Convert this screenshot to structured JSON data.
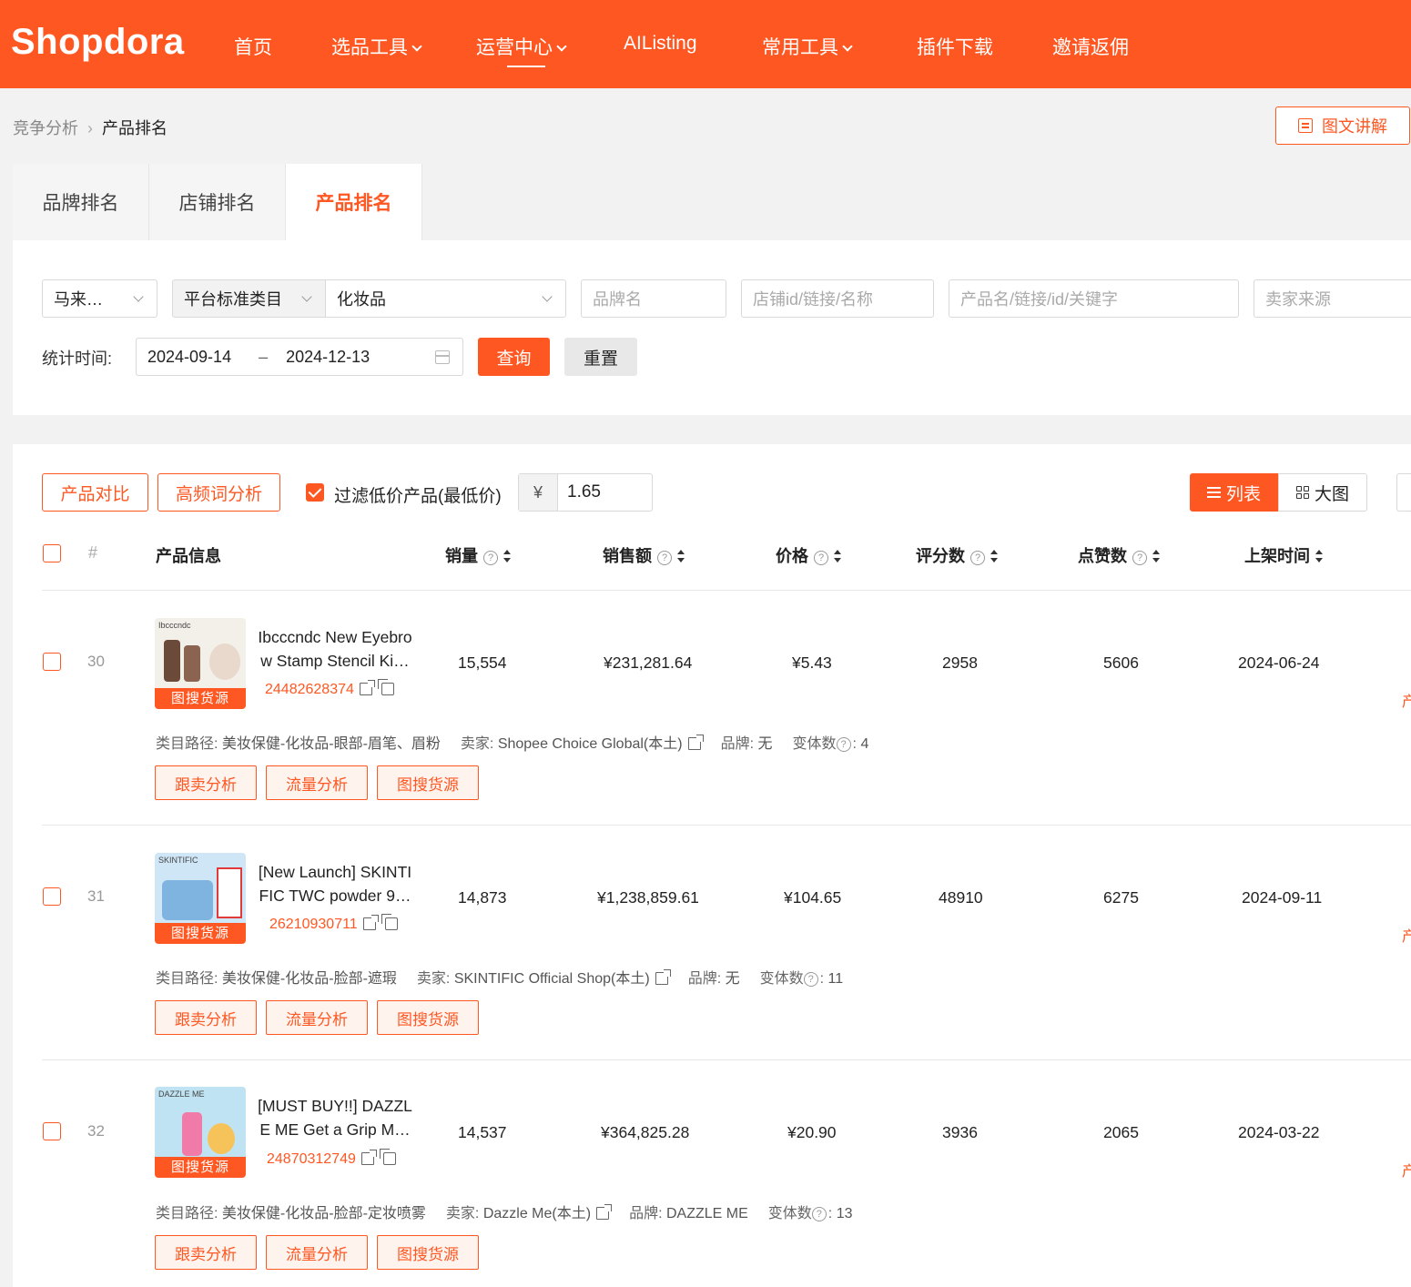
{
  "brand": {
    "logo": "Shopdora"
  },
  "nav": [
    {
      "label": "首页",
      "has_menu": false
    },
    {
      "label": "选品工具",
      "has_menu": true
    },
    {
      "label": "运营中心",
      "has_menu": true,
      "active": true
    },
    {
      "label": "AIListing",
      "has_menu": false
    },
    {
      "label": "常用工具",
      "has_menu": true
    },
    {
      "label": "插件下载",
      "has_menu": false
    },
    {
      "label": "邀请返佣",
      "has_menu": false
    }
  ],
  "breadcrumb": {
    "parent": "竞争分析",
    "current": "产品排名"
  },
  "guide_button": "图文讲解",
  "tabs": [
    {
      "label": "品牌排名"
    },
    {
      "label": "店铺排名"
    },
    {
      "label": "产品排名",
      "active": true
    }
  ],
  "filters": {
    "market": "马来…",
    "category_type": "平台标准类目",
    "category": "化妆品",
    "brand_placeholder": "品牌名",
    "shop_placeholder": "店铺id/链接/名称",
    "product_placeholder": "产品名/链接/id/关键字",
    "seller_source_placeholder": "卖家来源",
    "time_label": "统计时间:",
    "date_start": "2024-09-14",
    "date_sep": "–",
    "date_end": "2024-12-13",
    "query_button": "查询",
    "reset_button": "重置"
  },
  "toolbar": {
    "compare_button": "产品对比",
    "keyword_button": "高频词分析",
    "filter_low_price_label": "过滤低价产品(最低价)",
    "filter_low_price_checked": true,
    "currency": "¥",
    "min_price": "1.65",
    "view_list": "列表",
    "view_grid": "大图"
  },
  "table": {
    "columns": {
      "index": "#",
      "info": "产品信息",
      "sales": "销量",
      "revenue": "销售额",
      "price": "价格",
      "rating_count": "评分数",
      "likes": "点赞数",
      "listed": "上架时间"
    },
    "image_badge": "图搜货源",
    "meta_labels": {
      "category": "类目路径:",
      "seller": "卖家:",
      "brand": "品牌:",
      "variants": "变体数",
      "variants_suffix": ":"
    },
    "action_labels": {
      "follow": "跟卖分析",
      "traffic": "流量分析",
      "image_search": "图搜货源"
    },
    "rows": [
      {
        "rank": "30",
        "name": "Ibcccndc New Eyebrow Stamp Stencil Ki…",
        "name_line1": "Ibcccndc New Eyebro",
        "name_line2": "w Stamp Stencil Ki…",
        "thumb_text": "Ibcccndc",
        "thumb_color": "#f3efe9",
        "id": "24482628374",
        "sales": "15,554",
        "revenue": "¥231,281.64",
        "price": "¥5.43",
        "rating_count": "2958",
        "likes": "5606",
        "listed": "2024-06-24",
        "category_path": "美妆保健-化妆品-眼部-眉笔、眉粉",
        "seller": "Shopee Choice Global(本土)",
        "brand": "无",
        "variants": "4"
      },
      {
        "rank": "31",
        "name": "[New Launch] SKINTIFIC TWC powder 9…",
        "name_line1": "[New Launch] SKINTI",
        "name_line2": "FIC TWC powder 9…",
        "thumb_text": "SKINTIFIC",
        "thumb_color": "#cfe6f7",
        "id": "26210930711",
        "sales": "14,873",
        "revenue": "¥1,238,859.61",
        "price": "¥104.65",
        "rating_count": "48910",
        "likes": "6275",
        "listed": "2024-09-11",
        "category_path": "美妆保健-化妆品-脸部-遮瑕",
        "seller": "SKINTIFIC Official Shop(本土)",
        "brand": "无",
        "variants": "11"
      },
      {
        "rank": "32",
        "name": "[MUST BUY!!] DAZZLE ME Get a Grip M…",
        "name_line1": "[MUST BUY!!] DAZZL",
        "name_line2": "E ME Get a Grip M…",
        "thumb_text": "DAZZLE ME",
        "thumb_color": "#bfe3f3",
        "id": "24870312749",
        "sales": "14,537",
        "revenue": "¥364,825.28",
        "price": "¥20.90",
        "rating_count": "3936",
        "likes": "2065",
        "listed": "2024-03-22",
        "category_path": "美妆保健-化妆品-脸部-定妆喷雾",
        "seller": "Dazzle Me(本土)",
        "brand": "DAZZLE ME",
        "variants": "13"
      }
    ]
  },
  "colors": {
    "accent": "#ff5722",
    "page_bg": "#f2f2f2"
  }
}
